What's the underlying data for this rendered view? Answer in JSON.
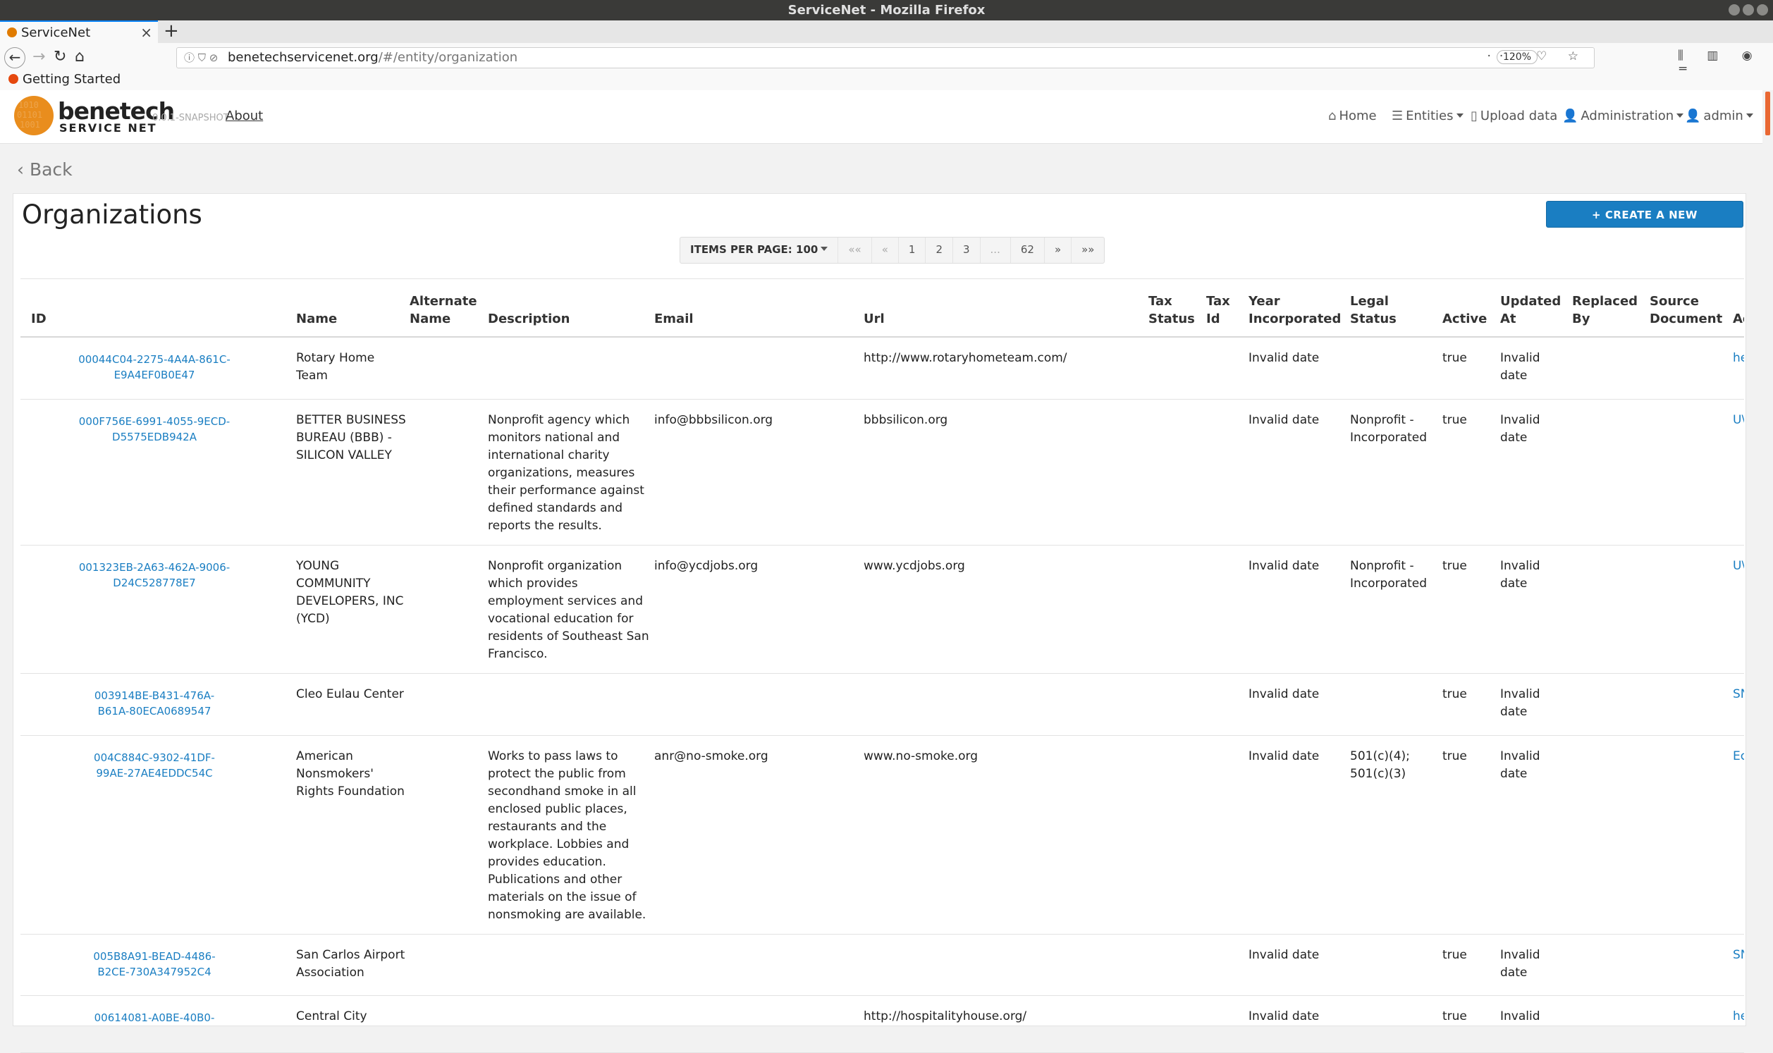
{
  "window": {
    "title": "ServiceNet - Mozilla Firefox"
  },
  "browser": {
    "tab_title": "ServiceNet",
    "tab_close": "×",
    "new_tab": "+",
    "url_host": "benetechservicenet.org",
    "url_path": "/#/entity/organization",
    "zoom": "120%",
    "bookmark": "Getting Started"
  },
  "app": {
    "brand": "benetech",
    "brand_sub": "SERVICE NET",
    "version": "0.0.1-SNAPSHOT",
    "about": "About",
    "menu": {
      "home": "Home",
      "entities": "Entities",
      "upload": "Upload data",
      "administration": "Administration",
      "admin": "admin"
    }
  },
  "page": {
    "back": "Back",
    "title": "Organizations",
    "create_button": "+ CREATE A NEW ORGANIZATION",
    "pagination": {
      "items_per_page": "ITEMS PER PAGE: 100",
      "first": "««",
      "prev": "«",
      "p1": "1",
      "p2": "2",
      "p3": "3",
      "ellipsis": "...",
      "last_page": "62",
      "next": "»",
      "last": "»»"
    }
  },
  "table": {
    "headers": {
      "id": "ID",
      "name": "Name",
      "alternate_name": "Alternate\nName",
      "description": "Description",
      "email": "Email",
      "url": "Url",
      "tax_status": "Tax\nStatus",
      "tax_id": "Tax\nId",
      "year_incorporated": "Year\nIncorporated",
      "legal_status": "Legal\nStatus",
      "active": "Active",
      "updated_at": "Updated\nAt",
      "replaced_by": "Replaced\nBy",
      "source_document": "Source\nDocument",
      "account": "Ac"
    },
    "rows": [
      {
        "id": "00044C04-2275-4A4A-861C-\nE9A4EF0B0E47",
        "name": "Rotary Home\nTeam",
        "description": "",
        "email": "",
        "url": "http://www.rotaryhometeam.com/",
        "year": "Invalid date",
        "legal": "",
        "active": "true",
        "updated": "Invalid\ndate",
        "account": "he"
      },
      {
        "id": "000F756E-6991-4055-9ECD-\nD5575EDB942A",
        "name": "BETTER BUSINESS\nBUREAU (BBB) -\nSILICON VALLEY",
        "description": "Nonprofit agency which\nmonitors national and\ninternational charity\norganizations, measures\ntheir performance against\ndefined standards and\nreports the results.",
        "email": "info@bbbsilicon.org",
        "url": "bbbsilicon.org",
        "year": "Invalid date",
        "legal": "Nonprofit -\nIncorporated",
        "active": "true",
        "updated": "Invalid\ndate",
        "account": "U\\"
      },
      {
        "id": "001323EB-2A63-462A-9006-\nD24C528778E7",
        "name": "YOUNG\nCOMMUNITY\nDEVELOPERS, INC\n(YCD)",
        "description": "Nonprofit organization\nwhich provides\nemployment services and\nvocational education for\nresidents of Southeast San\nFrancisco.",
        "email": "info@ycdjobs.org",
        "url": "www.ycdjobs.org",
        "year": "Invalid date",
        "legal": "Nonprofit -\nIncorporated",
        "active": "true",
        "updated": "Invalid\ndate",
        "account": "U\\"
      },
      {
        "id": "003914BE-B431-476A-\nB61A-80ECA0689547",
        "name": "Cleo Eulau Center",
        "description": "",
        "email": "",
        "url": "",
        "year": "Invalid date",
        "legal": "",
        "active": "true",
        "updated": "Invalid\ndate",
        "account": "SN"
      },
      {
        "id": "004C884C-9302-41DF-\n99AE-27AE4EDDC54C",
        "name": "American\nNonsmokers'\nRights Foundation",
        "description": "Works to pass laws to\nprotect the public from\nsecondhand smoke in all\nenclosed public places,\nrestaurants and the\nworkplace. Lobbies and\nprovides education.\nPublications and other\nmaterials on the issue of\nnonsmoking are available.",
        "email": "anr@no-smoke.org",
        "url": "www.no-smoke.org",
        "year": "Invalid date",
        "legal": "501(c)(4);\n501(c)(3)",
        "active": "true",
        "updated": "Invalid\ndate",
        "account": "Ec"
      },
      {
        "id": "005B8A91-BEAD-4486-\nB2CE-730A347952C4",
        "name": "San Carlos Airport\nAssociation",
        "description": "",
        "email": "",
        "url": "",
        "year": "Invalid date",
        "legal": "",
        "active": "true",
        "updated": "Invalid\ndate",
        "account": "SN"
      },
      {
        "id": "00614081-A0BE-40B0-",
        "name": "Central City",
        "description": "",
        "email": "",
        "url": "http://hospitalityhouse.org/",
        "year": "Invalid date",
        "legal": "",
        "active": "true",
        "updated": "Invalid",
        "account": "he"
      }
    ]
  }
}
